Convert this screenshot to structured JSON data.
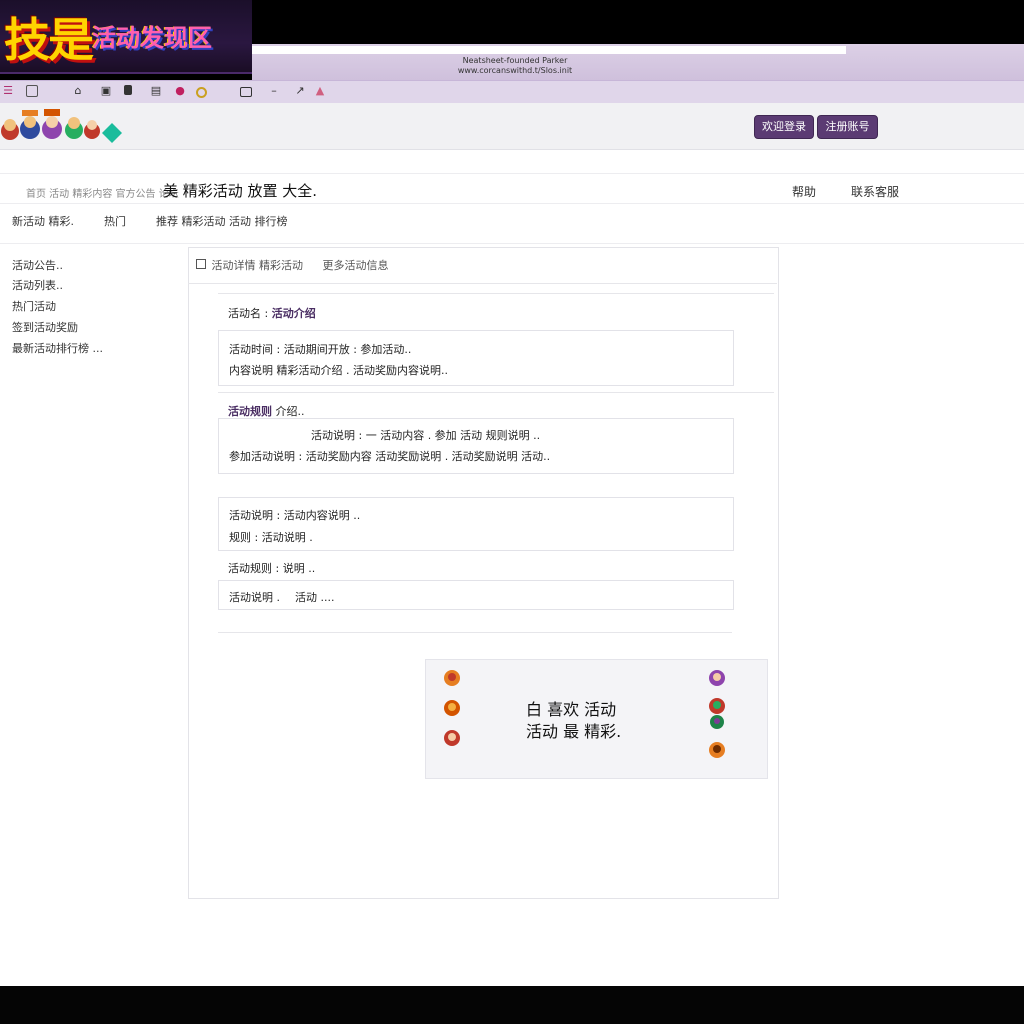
{
  "window": {
    "logo_main": "技是",
    "logo_sub": "活动发现区",
    "url_line1": "Neatsheet-founded Parker",
    "url_line2": "www.corcanswithd.t/Slos.init"
  },
  "toolbar": {
    "icons": [
      "menu-icon",
      "square-icon",
      "home-icon",
      "window-icon",
      "list-icon",
      "bookmark-icon",
      "dot-icon",
      "media-icon",
      "minus-icon",
      "arrow-icon",
      "star-icon"
    ]
  },
  "header": {
    "button_1": "欢迎登录",
    "button_2": "注册账号"
  },
  "title_row": {
    "crumb": "首页 活动 精彩内容 官方公告 论坛",
    "title": "美 精彩活动 放置 大全.",
    "right_1": "帮助",
    "right_2": "联系客服"
  },
  "subnav": {
    "item_1": "新活动 精彩.",
    "item_2": "热门",
    "item_3": "推荐 精彩活动 活动 排行榜"
  },
  "sidebar": {
    "items": [
      "活动公告..",
      "活动列表..",
      "热门活动",
      "签到活动奖励",
      "最新活动排行榜 ..."
    ]
  },
  "main": {
    "head_left": "活动详情 精彩活动",
    "head_right": "更多活动信息",
    "section1_label_plain": "活动名 :",
    "section1_label_bold": "活动介绍",
    "section1_line1": "活动时间 :  活动期间开放 :  参加活动..",
    "section1_line2": "内容说明 精彩活动介绍 .  活动奖励内容说明..",
    "section2_label_bold": "活动规则",
    "section2_label_plain": "介绍..",
    "section2_line1": "活动说明 :   一  活动内容 .  参加   活动  规则说明 ..",
    "section2_line2": "参加活动说明 :  活动奖励内容 活动奖励说明 . 活动奖励说明 活动..",
    "box3_line1": "活动说明 :  活动内容说明 ..",
    "box3_line2": "规则 :  活动说明 .",
    "section4_label": "活动规则 :  说明 ..",
    "box4_line1": "活动说明 .",
    "box4_line2": "活动 ...."
  },
  "promo": {
    "title": "白 喜欢 活动",
    "subtitle": "活动 最 精彩."
  },
  "colors": {
    "accent": "#5b3b73",
    "toolbar": "#e0d6ea",
    "header_bg": "#f1f1f3"
  }
}
